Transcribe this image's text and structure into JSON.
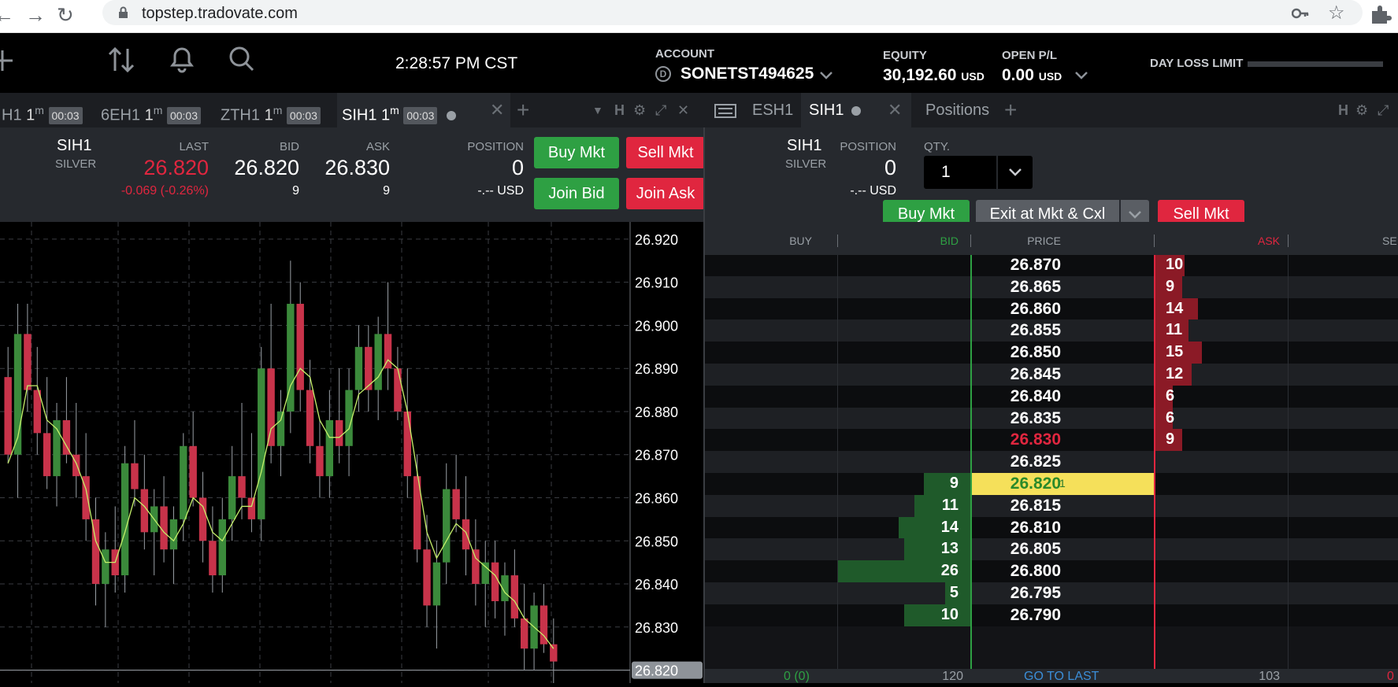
{
  "browser": {
    "url": "topstep.tradovate.com"
  },
  "header": {
    "time": "2:28:57 PM CST",
    "account_label": "ACCOUNT",
    "account_value": "SONETST494625",
    "account_badge": "D",
    "equity_label": "EQUITY",
    "equity_value": "30,192.60",
    "equity_unit": "USD",
    "openpl_label": "OPEN P/L",
    "openpl_value": "0.00",
    "openpl_unit": "USD",
    "dayloss_label": "DAY LOSS LIMIT"
  },
  "left_tabs": [
    {
      "label": "H1",
      "tf": "1",
      "tfsup": "m",
      "badge": "00:03"
    },
    {
      "label": "6EH1",
      "tf": "1",
      "tfsup": "m",
      "badge": "00:03"
    },
    {
      "label": "ZTH1",
      "tf": "1",
      "tfsup": "m",
      "badge": "00:03"
    },
    {
      "label": "SIH1",
      "tf": "1",
      "tfsup": "m",
      "badge": "00:03"
    }
  ],
  "right_tabs": [
    {
      "label": "ESH1"
    },
    {
      "label": "SIH1"
    },
    {
      "label": "Positions"
    }
  ],
  "quote": {
    "symbol": "SIH1",
    "name": "SILVER",
    "last_label": "LAST",
    "last": "26.820",
    "change": "-0.069 (-0.26%)",
    "bid_label": "BID",
    "bid": "26.820",
    "bid_size": "9",
    "ask_label": "ASK",
    "ask": "26.830",
    "ask_size": "9",
    "position_label": "POSITION",
    "position": "0",
    "position_usd": "-.-- USD",
    "buy_mkt": "Buy Mkt",
    "sell_mkt": "Sell Mkt",
    "join_bid": "Join Bid",
    "join_ask": "Join Ask"
  },
  "dom_header": {
    "symbol": "SIH1",
    "name": "SILVER",
    "position_label": "POSITION",
    "position": "0",
    "position_usd": "-.-- USD",
    "qty_label": "QTY.",
    "qty": "1",
    "buy_mkt": "Buy Mkt",
    "exit_mkt": "Exit at Mkt & Cxl",
    "sell_mkt": "Sell Mkt",
    "col_buy": "BUY",
    "col_bid": "BID",
    "col_price": "PRICE",
    "col_ask": "ASK",
    "col_sell": "SE"
  },
  "dom_footer": {
    "buy_total": "0 (0)",
    "bid_total": "120",
    "go_to_last": "GO TO LAST",
    "ask_total": "103",
    "sell_total": "0"
  },
  "dom_rows": [
    {
      "price": "26.870",
      "ask": "10",
      "ask_frac": 0.23
    },
    {
      "price": "26.865",
      "ask": "9",
      "ask_frac": 0.21
    },
    {
      "price": "26.860",
      "ask": "14",
      "ask_frac": 0.33
    },
    {
      "price": "26.855",
      "ask": "11",
      "ask_frac": 0.26
    },
    {
      "price": "26.850",
      "ask": "15",
      "ask_frac": 0.36
    },
    {
      "price": "26.845",
      "ask": "12",
      "ask_frac": 0.28
    },
    {
      "price": "26.840",
      "ask": "6",
      "ask_frac": 0.14
    },
    {
      "price": "26.835",
      "ask": "6",
      "ask_frac": 0.14
    },
    {
      "price": "26.830",
      "ask": "9",
      "ask_frac": 0.21,
      "price_color": "#e0263f"
    },
    {
      "price": "26.825"
    },
    {
      "price": "26.820",
      "bid": "9",
      "bid_frac": 0.35,
      "last_volume": "1",
      "is_last": true
    },
    {
      "price": "26.815",
      "bid": "11",
      "bid_frac": 0.42
    },
    {
      "price": "26.810",
      "bid": "14",
      "bid_frac": 0.54
    },
    {
      "price": "26.805",
      "bid": "13",
      "bid_frac": 0.5
    },
    {
      "price": "26.800",
      "bid": "26",
      "bid_frac": 1.0
    },
    {
      "price": "26.795",
      "bid": "5",
      "bid_frac": 0.19
    },
    {
      "price": "26.790",
      "bid": "10",
      "bid_frac": 0.5
    }
  ],
  "chart_data": {
    "type": "candlestick",
    "y_ticks": [
      "26.920",
      "26.910",
      "26.900",
      "26.890",
      "26.880",
      "26.870",
      "26.860",
      "26.850",
      "26.840",
      "26.830",
      "26.820"
    ],
    "ylim": [
      26.817,
      26.924
    ],
    "last_price_label": "26.820",
    "last_price": 26.82,
    "candles": [
      [
        26.888,
        26.895,
        26.868,
        26.87
      ],
      [
        26.87,
        26.905,
        26.86,
        26.898
      ],
      [
        26.898,
        26.905,
        26.88,
        26.885
      ],
      [
        26.885,
        26.895,
        26.87,
        26.875
      ],
      [
        26.875,
        26.888,
        26.862,
        26.865
      ],
      [
        26.865,
        26.882,
        26.858,
        26.878
      ],
      [
        26.878,
        26.888,
        26.868,
        26.87
      ],
      [
        26.87,
        26.882,
        26.86,
        26.865
      ],
      [
        26.865,
        26.875,
        26.85,
        26.855
      ],
      [
        26.855,
        26.86,
        26.835,
        26.84
      ],
      [
        26.84,
        26.852,
        26.83,
        26.848
      ],
      [
        26.848,
        26.858,
        26.838,
        26.842
      ],
      [
        26.842,
        26.872,
        26.838,
        26.868
      ],
      [
        26.868,
        26.878,
        26.858,
        26.862
      ],
      [
        26.862,
        26.87,
        26.848,
        26.852
      ],
      [
        26.852,
        26.862,
        26.842,
        26.858
      ],
      [
        26.858,
        26.865,
        26.845,
        26.848
      ],
      [
        26.848,
        26.858,
        26.84,
        26.855
      ],
      [
        26.855,
        26.875,
        26.85,
        26.872
      ],
      [
        26.872,
        26.88,
        26.858,
        26.86
      ],
      [
        26.86,
        26.866,
        26.845,
        26.85
      ],
      [
        26.85,
        26.858,
        26.838,
        26.842
      ],
      [
        26.842,
        26.86,
        26.838,
        26.855
      ],
      [
        26.855,
        26.872,
        26.85,
        26.865
      ],
      [
        26.865,
        26.882,
        26.855,
        26.86
      ],
      [
        26.86,
        26.875,
        26.852,
        26.855
      ],
      [
        26.855,
        26.895,
        26.85,
        26.89
      ],
      [
        26.89,
        26.905,
        26.868,
        26.872
      ],
      [
        26.872,
        26.885,
        26.865,
        26.88
      ],
      [
        26.88,
        26.915,
        26.875,
        26.905
      ],
      [
        26.905,
        26.91,
        26.88,
        26.885
      ],
      [
        26.885,
        26.892,
        26.868,
        26.872
      ],
      [
        26.872,
        26.878,
        26.86,
        26.865
      ],
      [
        26.865,
        26.885,
        26.86,
        26.878
      ],
      [
        26.878,
        26.89,
        26.868,
        26.872
      ],
      [
        26.872,
        26.89,
        26.865,
        26.885
      ],
      [
        26.885,
        26.9,
        26.88,
        26.895
      ],
      [
        26.895,
        26.9,
        26.88,
        26.885
      ],
      [
        26.885,
        26.902,
        26.878,
        26.898
      ],
      [
        26.898,
        26.91,
        26.885,
        26.89
      ],
      [
        26.89,
        26.895,
        26.878,
        26.88
      ],
      [
        26.88,
        26.89,
        26.86,
        26.865
      ],
      [
        26.865,
        26.87,
        26.845,
        26.848
      ],
      [
        26.848,
        26.856,
        26.83,
        26.835
      ],
      [
        26.835,
        26.85,
        26.825,
        26.845
      ],
      [
        26.845,
        26.868,
        26.84,
        26.862
      ],
      [
        26.862,
        26.87,
        26.852,
        26.855
      ],
      [
        26.855,
        26.865,
        26.842,
        26.848
      ],
      [
        26.848,
        26.855,
        26.835,
        26.84
      ],
      [
        26.84,
        26.85,
        26.83,
        26.845
      ],
      [
        26.845,
        26.85,
        26.832,
        26.836
      ],
      [
        26.836,
        26.845,
        26.828,
        26.842
      ],
      [
        26.842,
        26.848,
        26.83,
        26.832
      ],
      [
        26.832,
        26.84,
        26.82,
        26.825
      ],
      [
        26.825,
        26.838,
        26.82,
        26.835
      ],
      [
        26.835,
        26.84,
        26.824,
        26.826
      ],
      [
        26.826,
        26.832,
        26.817,
        26.822
      ]
    ],
    "ma": [
      26.868,
      26.874,
      26.886,
      26.886,
      26.878,
      26.876,
      26.872,
      26.868,
      26.862,
      26.85,
      26.845,
      26.845,
      26.852,
      26.86,
      26.858,
      26.855,
      26.852,
      26.85,
      26.854,
      26.86,
      26.858,
      26.852,
      26.85,
      26.854,
      26.858,
      26.858,
      26.866,
      26.876,
      26.878,
      26.886,
      26.89,
      26.888,
      26.878,
      26.874,
      26.874,
      26.876,
      26.884,
      26.886,
      26.888,
      26.892,
      26.89,
      26.88,
      26.866,
      26.852,
      26.846,
      26.85,
      26.854,
      26.852,
      26.846,
      26.844,
      26.842,
      26.838,
      26.836,
      26.832,
      26.83,
      26.828,
      26.825
    ]
  }
}
